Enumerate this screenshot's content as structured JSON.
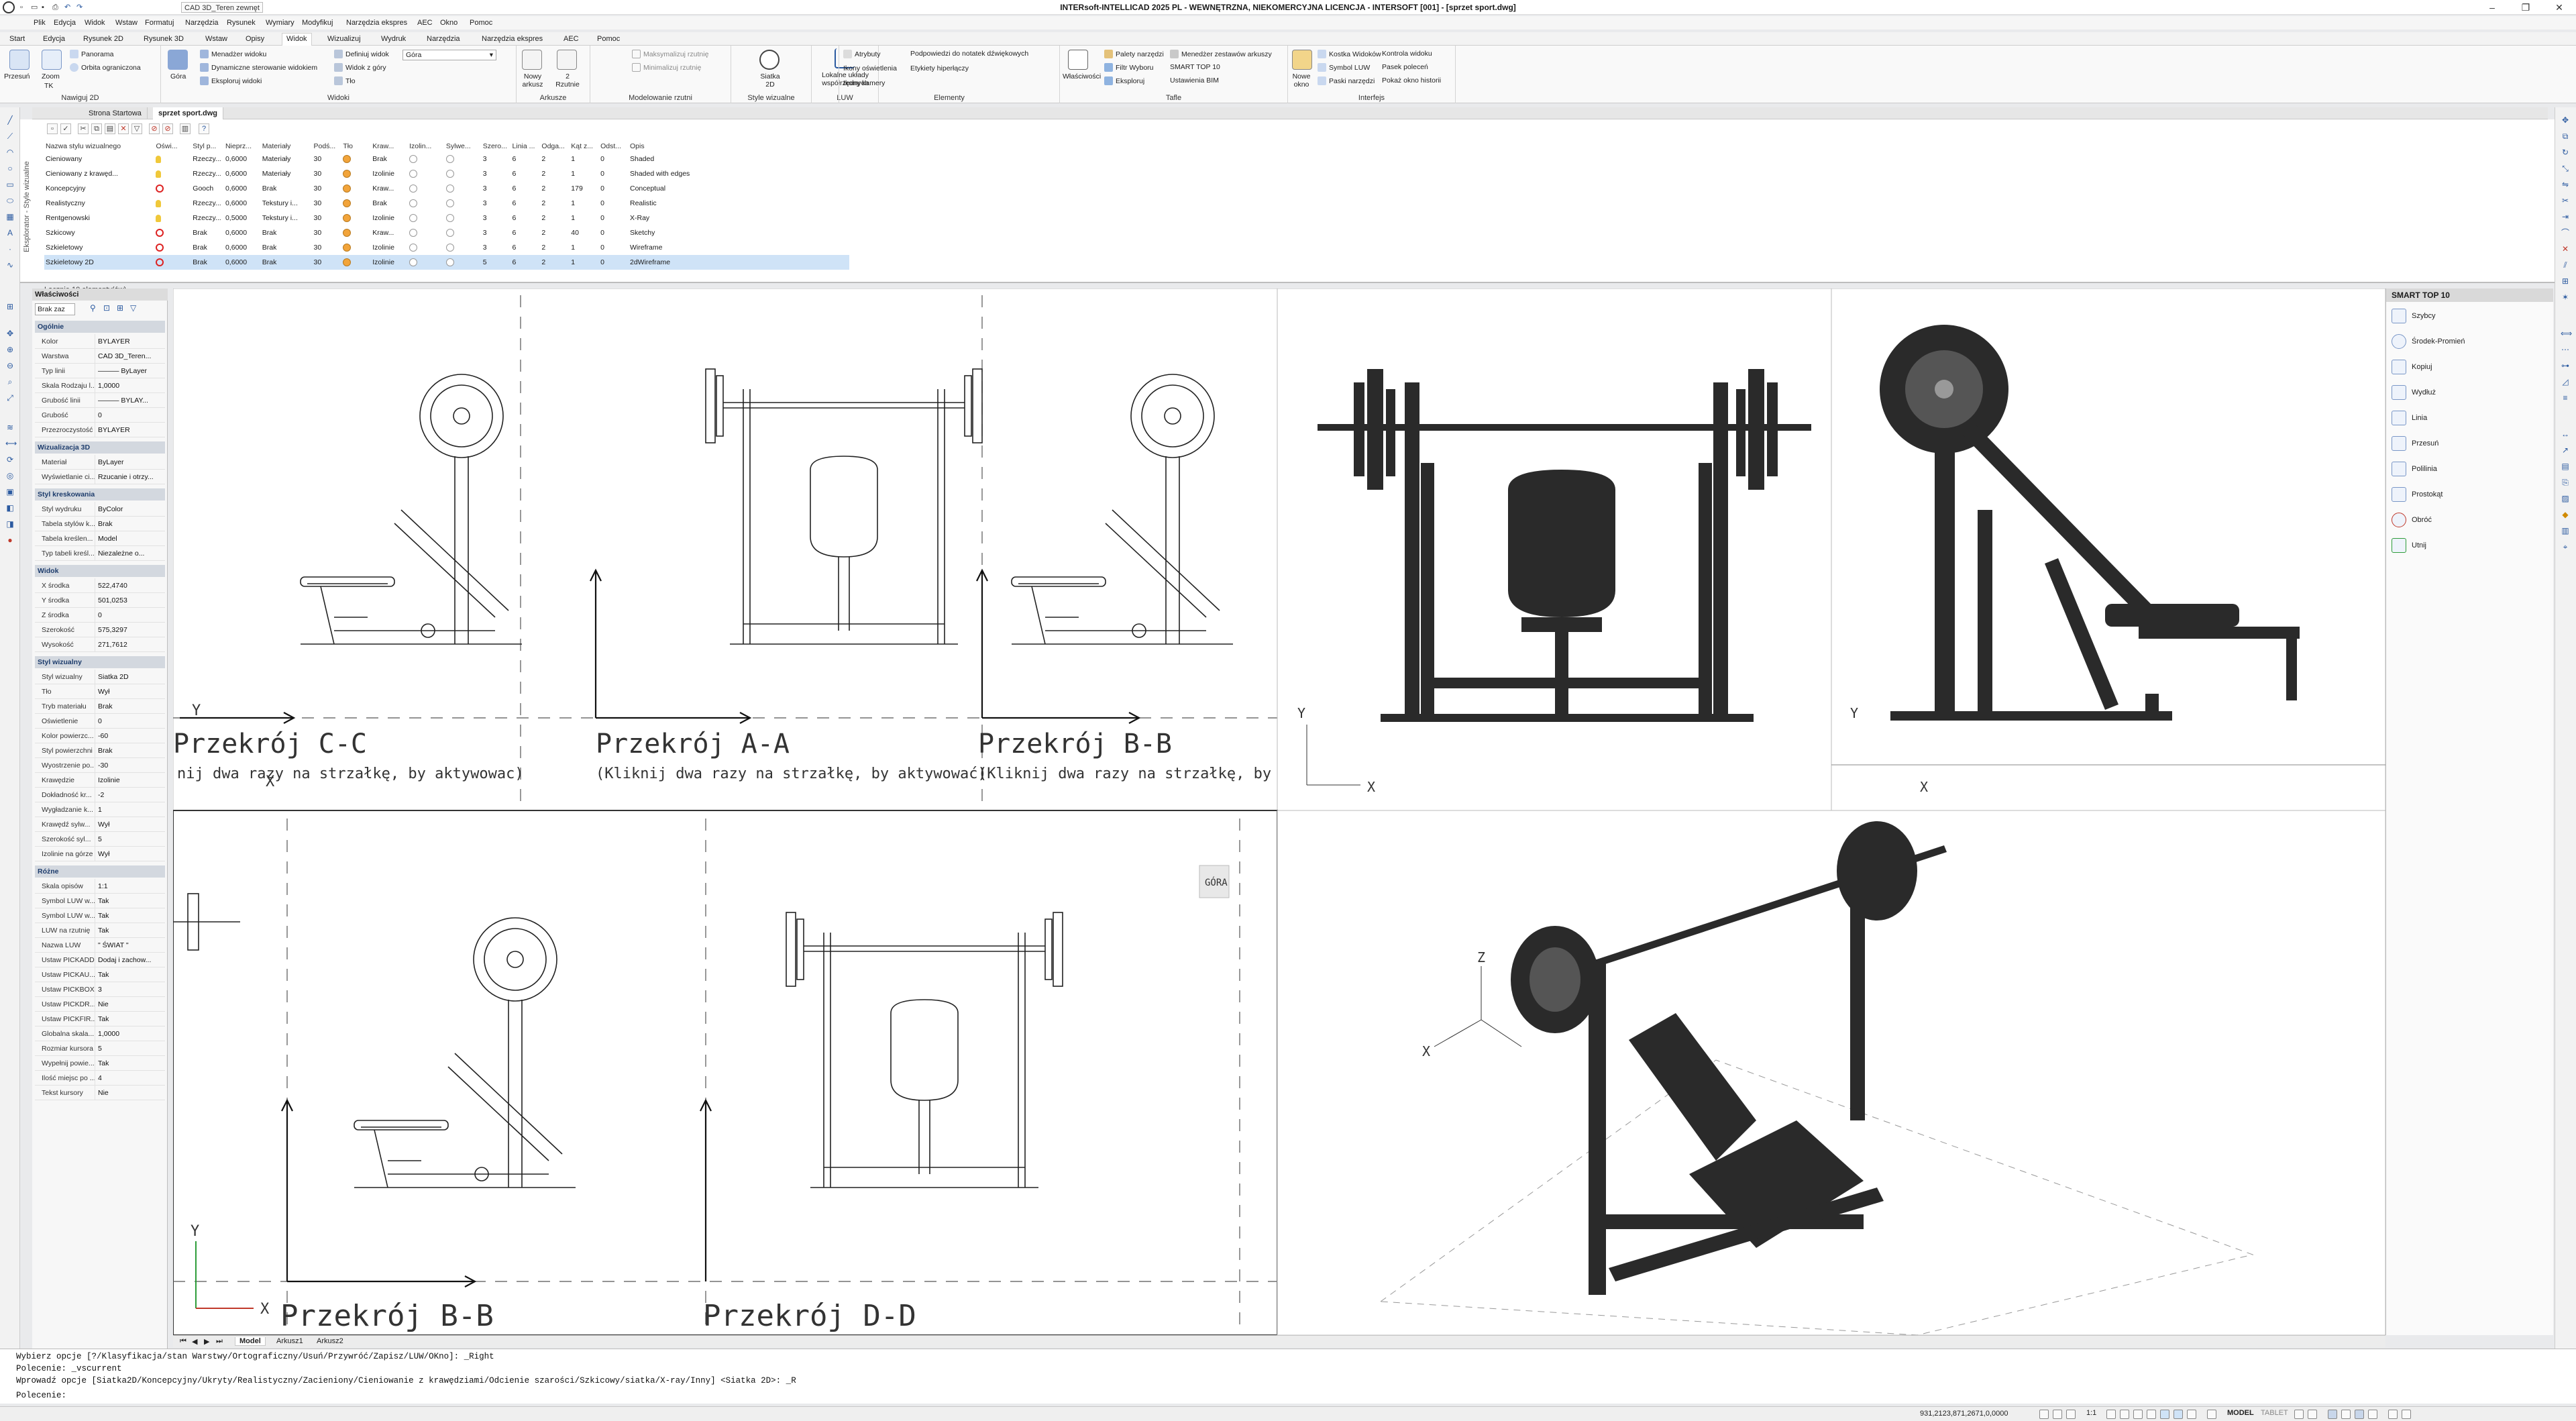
{
  "window": {
    "title": "INTERsoft-INTELLICAD 2025 PL - WEWNĘTRZNA, NIEKOMERCYJNA LICENCJA - INTERSOFT [001] - [sprzet sport.dwg]",
    "quick_layer": "CAD 3D_Teren zewnęt",
    "minimize": "–",
    "restore": "❐",
    "close": "✕"
  },
  "menubar": [
    "Plik",
    "Edycja",
    "Widok",
    "Wstaw",
    "Formatuj",
    "Narzędzia",
    "Rysunek",
    "Wymiary",
    "Modyfikuj",
    "Narzędzia ekspres",
    "AEC",
    "Okno",
    "Pomoc"
  ],
  "ribbon_tabs": [
    "Start",
    "Edycja",
    "Rysunek 2D",
    "Rysunek 3D",
    "Wstaw",
    "Opisy",
    "Widok",
    "Wizualizuj",
    "Wydruk",
    "Narzędzia",
    "Narzędzia ekspres",
    "AEC",
    "Pomoc"
  ],
  "ribbon_active_tab": "Widok",
  "ribbon": {
    "nav2d": {
      "label": "Nawiguj 2D",
      "przesun": "Przesuń",
      "zoom": "Zoom",
      "tk": "TK",
      "panorama": "Panorama",
      "orbita": "Orbita ograniczona",
      "gora": "Góra"
    },
    "widoki": {
      "label": "Widoki",
      "items": [
        "Menadżer widoku",
        "Dynamiczne sterowanie widokiem",
        "Eksploruj widoki",
        "Definiuj widok",
        "Widok z góry",
        "Tło"
      ],
      "combo": "Góra"
    },
    "arkusze": {
      "label": "Arkusze",
      "nowy": "Nowy arkusz",
      "rzutnie": "2 Rzutnie"
    },
    "rzutnie": {
      "label": "Modelowanie rzutni",
      "items": [
        "Maksymalizuj rzutnię",
        "Minimalizuj rzutnię"
      ]
    },
    "style": {
      "label": "Style wizualne",
      "siatka": "Siatka 2D"
    },
    "luw": {
      "label": "LUW",
      "lokalne": "Lokalne układy współrzędnych"
    },
    "elementy": {
      "label": "Elementy",
      "items": [
        "Atrybuty",
        "Podpowiedzi do notatek dźwiękowych",
        "Ikony oświetlenia",
        "Etykiety hiperłączy",
        "Ikony kamery"
      ]
    },
    "tafle": {
      "label": "Tafle",
      "wlasciwosci": "Właściwości",
      "items": [
        "Palety narzędzi",
        "Filtr Wyboru",
        "Eksploruj",
        "Menedżer zestawów arkuszy",
        "SMART TOP 10",
        "Ustawienia BIM"
      ]
    },
    "interfejs": {
      "label": "Interfejs",
      "nowe_okno": "Nowe okno",
      "items": [
        "Kostka Widoków",
        "Symbol LUW",
        "Paski narzędzi",
        "Kontrola widoku",
        "Pasek poleceń",
        "Pokaż okno historii"
      ]
    }
  },
  "doc_tabs": [
    "Strona Startowa",
    "sprzet sport.dwg"
  ],
  "explorer": {
    "side_label": "Eksplorator - Style wizualne",
    "headers": [
      "Nazwa stylu wizualnego",
      "Oświ...",
      "Styl p...",
      "Nieprz...",
      "Materiały",
      "Podś...",
      "Tło",
      "Kraw...",
      "Izolin...",
      "Sylwe...",
      "Szero...",
      "Linia ...",
      "Odga...",
      "Kąt z...",
      "Odst...",
      "Opis"
    ],
    "rows": [
      [
        "Cieniowany",
        "bulb",
        "Rzeczy...",
        "0,6000",
        "Materiały",
        "30",
        "",
        "Brak",
        "",
        "",
        "3",
        "6",
        "2",
        "1",
        "0",
        "Shaded"
      ],
      [
        "Cieniowany z krawęd...",
        "bulb",
        "Rzeczy...",
        "0,6000",
        "Materiały",
        "30",
        "",
        "Izolinie",
        "",
        "",
        "3",
        "6",
        "2",
        "1",
        "0",
        "Shaded with edges"
      ],
      [
        "Koncepcyjny",
        "stop",
        "Gooch",
        "0,6000",
        "Brak",
        "30",
        "",
        "Kraw...",
        "",
        "",
        "3",
        "6",
        "2",
        "179",
        "0",
        "Conceptual"
      ],
      [
        "Realistyczny",
        "bulb",
        "Rzeczy...",
        "0,6000",
        "Tekstury i...",
        "30",
        "",
        "Brak",
        "",
        "",
        "3",
        "6",
        "2",
        "1",
        "0",
        "Realistic"
      ],
      [
        "Rentgenowski",
        "bulb",
        "Rzeczy...",
        "0,5000",
        "Tekstury i...",
        "30",
        "",
        "Izolinie",
        "",
        "",
        "3",
        "6",
        "2",
        "1",
        "0",
        "X-Ray"
      ],
      [
        "Szkicowy",
        "stop",
        "Brak",
        "0,6000",
        "Brak",
        "30",
        "",
        "Kraw...",
        "",
        "",
        "3",
        "6",
        "2",
        "40",
        "0",
        "Sketchy"
      ],
      [
        "Szkieletowy",
        "stop",
        "Brak",
        "0,6000",
        "Brak",
        "30",
        "",
        "Izolinie",
        "",
        "",
        "3",
        "6",
        "2",
        "1",
        "0",
        "Wireframe"
      ],
      [
        "Szkieletowy 2D",
        "stop",
        "Brak",
        "0,6000",
        "Brak",
        "30",
        "",
        "Izolinie",
        "",
        "",
        "5",
        "6",
        "2",
        "1",
        "0",
        "2dWireframe"
      ]
    ],
    "status": "Łącznie 10 elementy(ów)"
  },
  "properties": {
    "title": "Właściwości",
    "selection": "Brak zaz",
    "sections": [
      {
        "name": "Ogólnie",
        "rows": [
          [
            "Kolor",
            "BYLAYER"
          ],
          [
            "Warstwa",
            "CAD 3D_Teren..."
          ],
          [
            "Typ linii",
            "——— ByLayer"
          ],
          [
            "Skala Rodzaju l...",
            "1,0000"
          ],
          [
            "Grubość linii",
            "——— BYLAY..."
          ],
          [
            "Grubość",
            "0"
          ],
          [
            "Przezroczystość",
            "BYLAYER"
          ]
        ]
      },
      {
        "name": "Wizualizacja 3D",
        "rows": [
          [
            "Materiał",
            "ByLayer"
          ],
          [
            "Wyświetlanie ci...",
            "Rzucanie i otrzy..."
          ]
        ]
      },
      {
        "name": "Styl kreskowania",
        "rows": [
          [
            "Styl wydruku",
            "ByColor"
          ],
          [
            "Tabela stylów k...",
            "Brak"
          ],
          [
            "Tabela kreślen...",
            "Model"
          ],
          [
            "Typ tabeli kreśl...",
            "Niezależne o..."
          ]
        ]
      },
      {
        "name": "Widok",
        "rows": [
          [
            "X środka",
            "522,4740"
          ],
          [
            "Y środka",
            "501,0253"
          ],
          [
            "Z środka",
            "0"
          ],
          [
            "Szerokość",
            "575,3297"
          ],
          [
            "Wysokość",
            "271,7612"
          ]
        ]
      },
      {
        "name": "Styl wizualny",
        "rows": [
          [
            "Styl wizualny",
            "Siatka 2D"
          ],
          [
            "Tło",
            "Wył"
          ],
          [
            "Tryb materiału",
            "Brak"
          ],
          [
            "Oświetlenie",
            "0"
          ],
          [
            "Kolor powierzc...",
            "-60"
          ],
          [
            "Styl powierzchni",
            "Brak"
          ],
          [
            "Wyostrzenie po...",
            "-30"
          ],
          [
            "Krawędzie",
            "Izolinie"
          ],
          [
            "Dokładność kr...",
            "-2"
          ],
          [
            "Wygładzanie k...",
            "1"
          ],
          [
            "Krawędź sylw...",
            "Wył"
          ],
          [
            "Szerokość syl...",
            "5"
          ],
          [
            "Izolinie na górze",
            "Wył"
          ]
        ]
      },
      {
        "name": "Różne",
        "rows": [
          [
            "Skala opisów",
            "1:1"
          ],
          [
            "Symbol LUW w...",
            "Tak"
          ],
          [
            "Symbol LUW w...",
            "Tak"
          ],
          [
            "LUW na rzutnię",
            "Tak"
          ],
          [
            "Nazwa LUW",
            "\" ŚWIAT \""
          ],
          [
            "Ustaw PICKADD",
            "Dodaj i zachow..."
          ],
          [
            "Ustaw PICKAU...",
            "Tak"
          ],
          [
            "Ustaw PICKBOX",
            "3"
          ],
          [
            "Ustaw PICKDR...",
            "Nie"
          ],
          [
            "Ustaw PICKFIR...",
            "Tak"
          ],
          [
            "Globalna skala...",
            "1,0000"
          ],
          [
            "Rozmiar kursora",
            "5"
          ],
          [
            "Wypełnij powie...",
            "Tak"
          ],
          [
            "Ilość miejsc po ...",
            "4"
          ],
          [
            "Tekst kursory",
            "Nie"
          ]
        ]
      }
    ]
  },
  "viewport": {
    "sections": [
      "Przekrój C-C",
      "Przekrój A-A",
      "Przekrój B-B",
      "Przekrój B-B",
      "Przekrój D-D"
    ],
    "hint": "(Kliknij dwa razy na strzałkę, by aktywować)",
    "hint_cut": "nij dwa razy na strzałkę, by aktywowac)",
    "hint_b": "(Kliknij dwa razy na strzałkę, by a",
    "cube_label": "GÓRA",
    "axes": {
      "x": "X",
      "y": "Y",
      "z": "Z"
    }
  },
  "smart_top": {
    "title": "SMART TOP 10",
    "items": [
      "Szybcy",
      "Środek-Promień",
      "Kopiuj",
      "Wydłuż",
      "Linia",
      "Przesuń",
      "Polilinia",
      "Prostokąt",
      "Obróć",
      "Utnij"
    ]
  },
  "layout_tabs": [
    "Model",
    "Arkusz1",
    "Arkusz2"
  ],
  "command": {
    "lines": [
      "Wybierz opcje [?/Klasyfikacja/stan Warstwy/Ortograficzny/Usuń/Przywróć/Zapisz/LUW/OKno]: _Right",
      "Polecenie: _vscurrent",
      "Wprowadź opcje [Siatka2D/Koncepcyjny/Ukryty/Realistyczny/Zacieniony/Cieniowanie z krawędziami/Odcienie szarości/Szkicowy/siatka/X-ray/Inny] <Siatka 2D>: _R",
      "Polecenie:"
    ]
  },
  "status": {
    "coords": "931,2123,871,2671,0,0000",
    "scale": "1:1",
    "model": "MODEL",
    "tablet": "TABLET"
  },
  "colors": {
    "accent": "#2b5aa0",
    "section_header": "#1d3c6c",
    "selected_row": "#cfe3f7",
    "equipment": "#2a2a2a"
  }
}
